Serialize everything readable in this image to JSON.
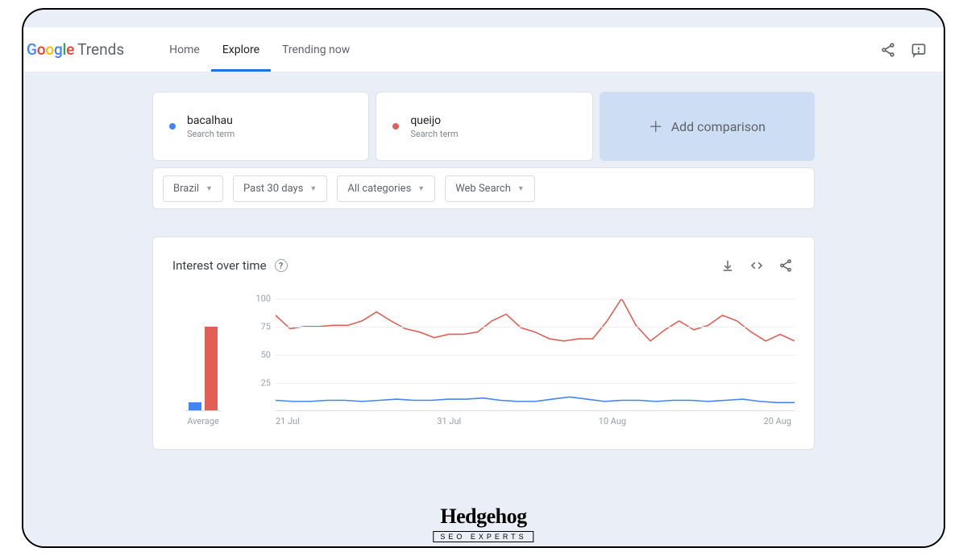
{
  "brand": {
    "google": "Google",
    "product": "Trends"
  },
  "nav": {
    "tabs": [
      {
        "label": "Home",
        "active": false
      },
      {
        "label": "Explore",
        "active": true
      },
      {
        "label": "Trending now",
        "active": false
      }
    ]
  },
  "icons": {
    "share": "share-icon",
    "feedback": "feedback-icon"
  },
  "compare": {
    "terms": [
      {
        "name": "bacalhau",
        "type": "Search term",
        "color": "#4285f4"
      },
      {
        "name": "queijo",
        "type": "Search term",
        "color": "#e06055"
      }
    ],
    "add_label": "Add comparison"
  },
  "filters": {
    "region": "Brazil",
    "time": "Past 30 days",
    "category": "All categories",
    "search_type": "Web Search"
  },
  "chart": {
    "title": "Interest over time",
    "help": "?",
    "avg_label": "Average"
  },
  "chart_data": {
    "type": "line",
    "ylim": [
      0,
      100
    ],
    "yticks": [
      25,
      50,
      75,
      100
    ],
    "x_labels": [
      "21 Jul",
      "31 Jul",
      "10 Aug",
      "20 Aug"
    ],
    "series": [
      {
        "name": "bacalhau",
        "color": "#4285f4",
        "avg": 7,
        "values": [
          9,
          8,
          8,
          9,
          9,
          8,
          9,
          10,
          9,
          9,
          10,
          10,
          11,
          9,
          8,
          8,
          10,
          12,
          10,
          8,
          9,
          9,
          8,
          9,
          9,
          8,
          9,
          10,
          8,
          7,
          7
        ]
      },
      {
        "name": "queijo",
        "color": "#e06055",
        "avg": 74,
        "values": [
          85,
          73,
          75,
          75,
          76,
          76,
          80,
          88,
          80,
          73,
          70,
          65,
          68,
          68,
          70,
          80,
          86,
          74,
          70,
          64,
          62,
          64,
          64,
          80,
          100,
          76,
          62,
          72,
          80,
          72,
          76,
          85,
          80,
          70,
          62,
          68,
          62
        ]
      }
    ]
  },
  "watermark": {
    "top": "Hedgehog",
    "bottom": "SEO EXPERTS"
  }
}
